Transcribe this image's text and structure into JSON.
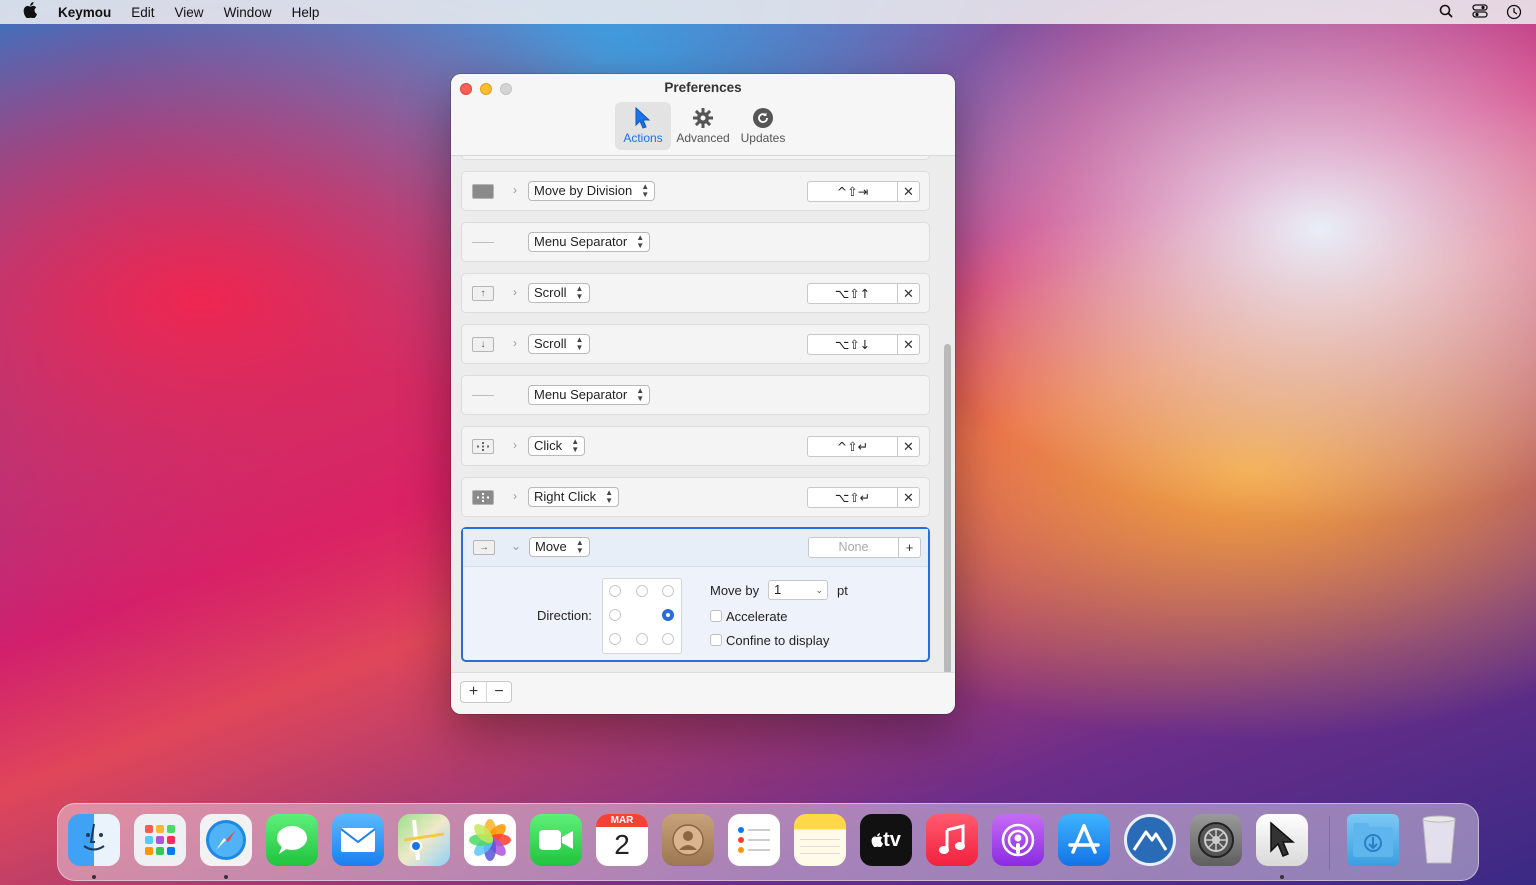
{
  "menubar": {
    "app_name": "Keymou",
    "items": [
      "Edit",
      "View",
      "Window",
      "Help"
    ]
  },
  "window": {
    "title": "Preferences",
    "tabs": [
      {
        "label": "Actions",
        "icon": "cursor-arrow-icon",
        "active": true
      },
      {
        "label": "Advanced",
        "icon": "gear-icon",
        "active": false
      },
      {
        "label": "Updates",
        "icon": "refresh-icon",
        "active": false
      }
    ],
    "rows": [
      {
        "action": "Move by Division",
        "shortcut": "^⇧⇥"
      },
      {
        "action": "Menu Separator",
        "shortcut": null
      },
      {
        "action": "Scroll",
        "icon": "↑",
        "shortcut": "⌥⇧↑"
      },
      {
        "action": "Scroll",
        "icon": "↓",
        "shortcut": "⌥⇧↓"
      },
      {
        "action": "Menu Separator",
        "shortcut": null
      },
      {
        "action": "Click",
        "shortcut": "^⇧↵"
      },
      {
        "action": "Right Click",
        "shortcut": "⌥⇧↵"
      },
      {
        "action": "Move",
        "icon": "→",
        "shortcut": "None"
      }
    ],
    "move_panel": {
      "direction_label": "Direction:",
      "move_by_label": "Move by",
      "move_by_value": "1",
      "unit": "pt",
      "accelerate_label": "Accelerate",
      "confine_label": "Confine to display",
      "selected_direction": "right"
    },
    "bottom": {
      "add": "+",
      "remove": "−"
    }
  },
  "dock": {
    "apps": [
      "Finder",
      "Launchpad",
      "Safari",
      "Messages",
      "Mail",
      "Maps",
      "Photos",
      "FaceTime",
      "Calendar",
      "Contacts",
      "Reminders",
      "Notes",
      "TV",
      "Music",
      "Podcasts",
      "App Store",
      "Altair",
      "System Preferences",
      "Keymou",
      "Downloads",
      "Trash"
    ],
    "calendar_month": "MAR",
    "calendar_day": "2",
    "tv_label": "tv"
  },
  "colors": {
    "accent": "#2a6dd6",
    "close": "#fe5f57",
    "minimize": "#febc2e"
  }
}
